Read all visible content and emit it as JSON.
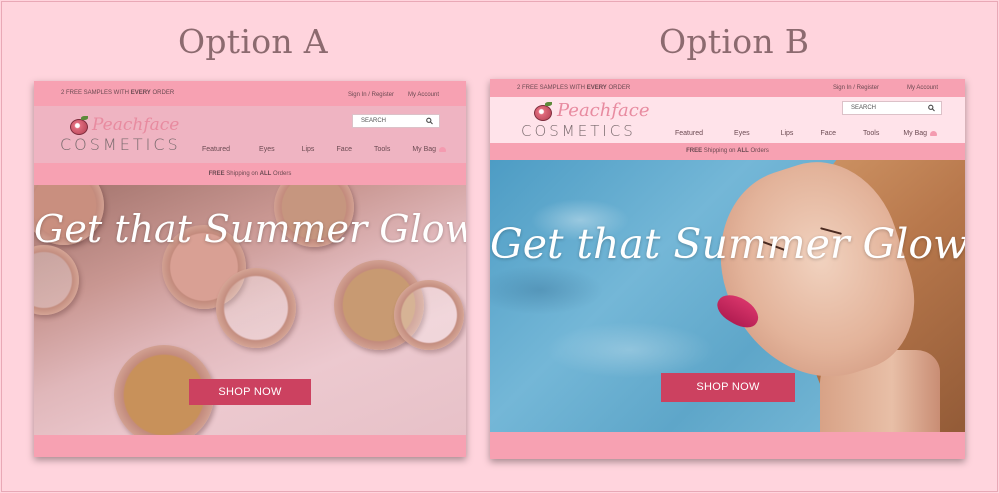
{
  "options": [
    {
      "title": "Option A",
      "promo_prefix": "2 FREE SAMPLES WITH ",
      "promo_bold": "EVERY",
      "promo_suffix": " ORDER",
      "sign_in": "Sign In / Register",
      "my_account": "My Account",
      "logo_script": "Peachface",
      "logo_caps": "COSMETICS",
      "search_placeholder": "SEARCH",
      "nav": [
        "Featured",
        "Eyes",
        "Lips",
        "Face",
        "Tools",
        "My Bag"
      ],
      "shipping_bold": "FREE",
      "shipping_mid": " Shipping on ",
      "shipping_bold2": "ALL",
      "shipping_suffix": " Orders",
      "headline": "Get that Summer Glow",
      "cta": "SHOP NOW"
    },
    {
      "title": "Option B",
      "promo_prefix": "2 FREE SAMPLES WITH ",
      "promo_bold": "EVERY",
      "promo_suffix": " ORDER",
      "sign_in": "Sign In / Register",
      "my_account": "My Account",
      "logo_script": "Peachface",
      "logo_caps": "COSMETICS",
      "search_placeholder": "SEARCH",
      "nav": [
        "Featured",
        "Eyes",
        "Lips",
        "Face",
        "Tools",
        "My Bag"
      ],
      "shipping_bold": "FREE",
      "shipping_mid": " Shipping on ",
      "shipping_bold2": "ALL",
      "shipping_suffix": " Orders",
      "headline": "Get that Summer Glow",
      "cta": "SHOP NOW"
    }
  ],
  "colors": {
    "background": "#ffd4dd",
    "topbar_pink": "#f7a1b2",
    "cta": "#cc4160",
    "title_text": "#8c6a6f"
  },
  "icons": [
    "peach-logo-icon",
    "search-icon",
    "bag-icon"
  ]
}
